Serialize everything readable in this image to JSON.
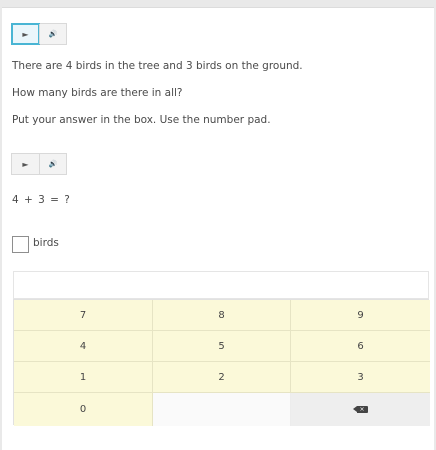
{
  "audio": {
    "play_icon": "play-icon",
    "speaker_icon": "speaker-icon",
    "play_glyph": "►",
    "speaker_glyph": "🔊"
  },
  "question": {
    "line1": "There are 4 birds in the tree and 3 birds on the ground.",
    "line2": "How many birds are there in all?",
    "line3": "Put your answer in the box. Use the number pad.",
    "equation": "4 + 3 = ?"
  },
  "answer": {
    "value": "",
    "unit_label": "birds"
  },
  "numpad": {
    "keys": [
      "7",
      "8",
      "9",
      "4",
      "5",
      "6",
      "1",
      "2",
      "3",
      "0"
    ],
    "backspace_icon": "backspace-icon"
  },
  "colors": {
    "key_bg": "#fbf9d9",
    "focus_ring": "#49b5d4",
    "backspace_bg": "#eeeeee"
  }
}
